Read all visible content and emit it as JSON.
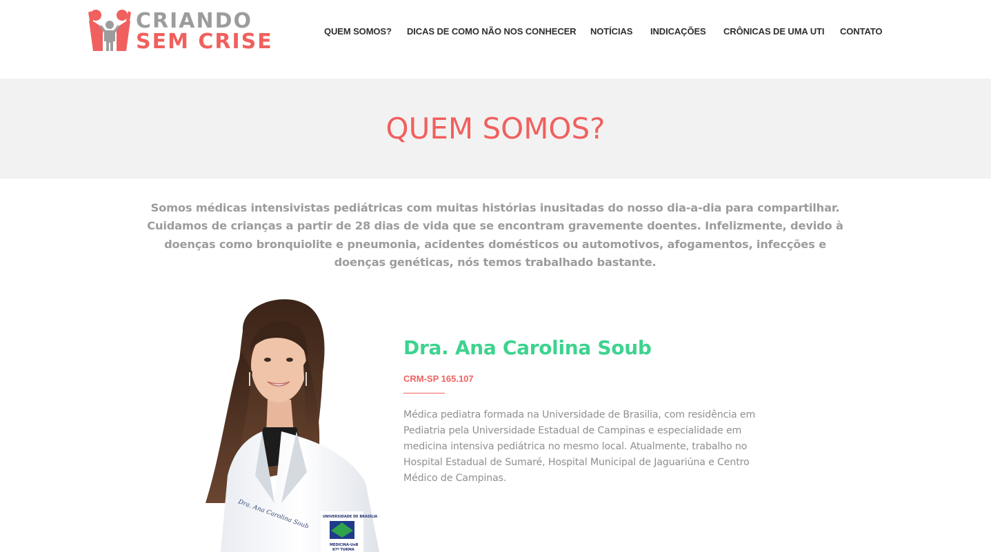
{
  "header": {
    "logo": {
      "line1": "CRIANDO",
      "line2": "SEM CRISE",
      "mark_icon": "family-figures-icon"
    },
    "nav": [
      {
        "label": "QUEM SOMOS?"
      },
      {
        "label": "DICAS DE COMO NÃO NOS CONHECER"
      },
      {
        "label": "NOTÍCIAS"
      },
      {
        "label": "INDICAÇÕES"
      },
      {
        "label": "CRÔNICAS DE UMA UTI"
      },
      {
        "label": "CONTATO"
      }
    ]
  },
  "title_band": {
    "title": "QUEM SOMOS?"
  },
  "intro": {
    "text": "Somos médicas intensivistas pediátricas com muitas histórias inusitadas do nosso dia-a-dia para compartilhar. Cuidamos de crianças a partir de 28 dias de vida que se encontram gravemente doentes. Infelizmente, devido à doenças como bronquiolite e pneumonia, acidentes domésticos ou automotivos, afogamentos, infecções e doenças genéticas, nós temos trabalhado bastante."
  },
  "doctor": {
    "name": "Dra. Ana Carolina Soub",
    "crm": "CRM-SP 165.107",
    "bio": "Médica pediatra formada na Universidade de Brasilia, com residência em Pediatria pela Universidade Estadual de Campinas e especialidade em medicina intensiva pediátrica no mesmo local. Atualmente, trabalho no Hospital Estadual de Sumaré, Hospital Municipal de Jaguariúna e Centro Médico de Campinas.",
    "photo": {
      "coat_embroidery": "Dra. Ana Carolina Soub",
      "patch_top": "UNIVERSIDADE DE BRASÍLIA",
      "patch_bottom": "MEDICINA-UnB",
      "patch_class": "87ª TURMA"
    }
  },
  "colors": {
    "accent_coral": "#f0605e",
    "accent_green": "#3dd38f",
    "logo_gray": "#9c9c9c",
    "band_bg": "#f2f2f2",
    "nav_text": "#2e2e2e"
  }
}
